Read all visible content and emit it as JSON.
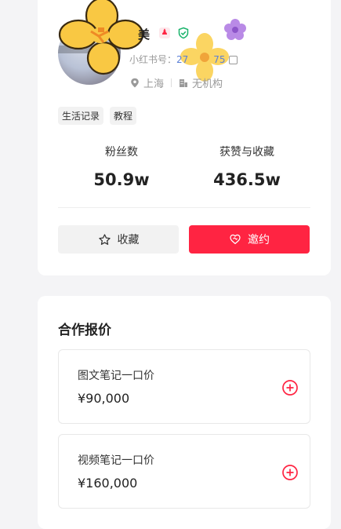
{
  "profile": {
    "name": "美",
    "id_label": "小红书号：",
    "id_value_start": "27",
    "id_value_end": "75",
    "location": "上海",
    "organization": "无机构",
    "tags": [
      "生活记录",
      "教程"
    ]
  },
  "stats": {
    "followers_label": "粉丝数",
    "followers_value": "50.9w",
    "likes_label": "获赞与收藏",
    "likes_value": "436.5w"
  },
  "actions": {
    "favorite_label": "收藏",
    "invite_label": "邀约"
  },
  "pricing": {
    "title": "合作报价",
    "items": [
      {
        "name": "图文笔记一口价",
        "price": "¥90,000"
      },
      {
        "name": "视频笔记一口价",
        "price": "¥160,000"
      }
    ]
  },
  "colors": {
    "accent": "#ff2442",
    "link": "#5b7fd6",
    "verified": "#19b36b"
  }
}
